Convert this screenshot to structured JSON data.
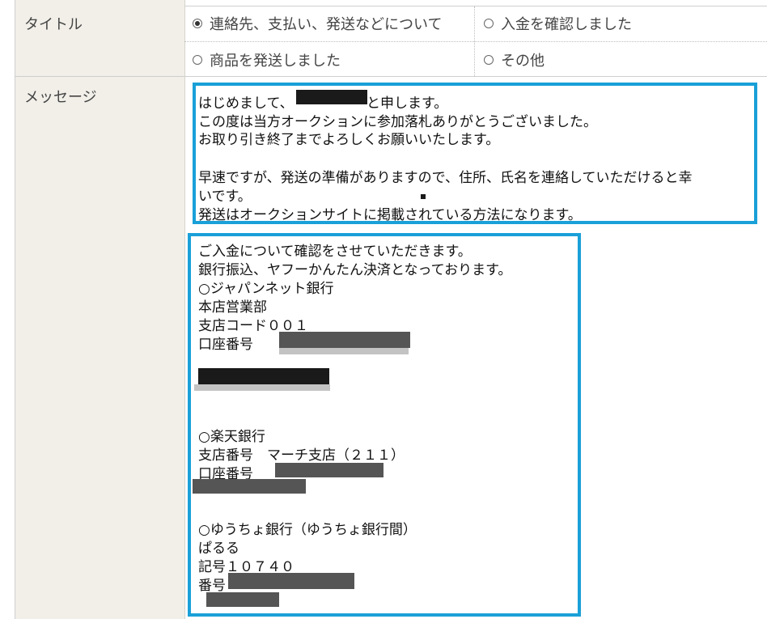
{
  "title_row": {
    "label": "タイトル",
    "options": [
      {
        "label": "連絡先、支払い、発送などについて",
        "selected": true
      },
      {
        "label": "入金を確認しました",
        "selected": false
      },
      {
        "label": "商品を発送しました",
        "selected": false
      },
      {
        "label": "その他",
        "selected": false
      }
    ]
  },
  "message_row": {
    "label": "メッセージ",
    "box1": [
      "はじめまして、",
      "と申します。",
      "この度は当方オークションに参加落札ありがとうございました。",
      "お取り引き終了までよろしくお願いいたします。",
      "早速ですが、発送の準備がありますので、住所、氏名を連絡していただけると幸",
      "いです。",
      "発送はオークションサイトに掲載されている方法になります。"
    ],
    "box2": [
      "ご入金について確認をさせていただきます。",
      "銀行振込、ヤフーかんたん決済となっております。",
      "○ジャパンネット銀行",
      "本店営業部",
      "支店コード００１",
      "口座番号",
      "○楽天銀行",
      "支店番号　マーチ支店（２１１）",
      "口座番号",
      "○ゆうちょ銀行（ゆうちょ銀行間）",
      "ぱるる",
      "記号１０７４０",
      "番号"
    ]
  },
  "colors": {
    "accent": "#1aa0d8",
    "label_bg": "#f1efe8"
  }
}
